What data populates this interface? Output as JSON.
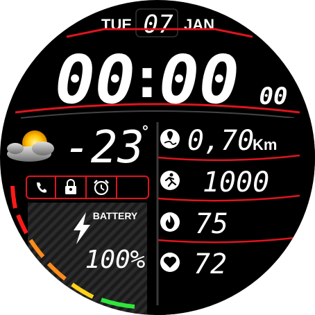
{
  "date": {
    "weekday": "TUE",
    "day": "07",
    "month": "JAN"
  },
  "time": {
    "hours": "00",
    "separator": ":",
    "minutes": "00",
    "seconds": "00"
  },
  "weather": {
    "temperature": "-23",
    "unit": "°",
    "icon": "partly-cloudy-icon"
  },
  "status_icons": [
    "phone-icon",
    "lock-icon",
    "alarm-icon",
    "empty-slot"
  ],
  "battery": {
    "label": "BATTERY",
    "value": "100%",
    "level": 1.0,
    "icon": "lightning-icon"
  },
  "stats": {
    "distance": {
      "value": "0,70",
      "unit": "Km",
      "icon": "distance-map-icon"
    },
    "steps": {
      "value": "1000",
      "icon": "running-person-icon"
    },
    "calories": {
      "value": "75",
      "icon": "flame-icon"
    },
    "heart_rate": {
      "value": "72",
      "icon": "heart-icon"
    }
  },
  "colors": {
    "accent_red": "#e0141e",
    "background": "#000000",
    "scale_left": [
      "#ff1a1a",
      "#ff1a1a",
      "#ff8c1a",
      "#ffd21a",
      "#a0e61a",
      "#2ee63a"
    ],
    "scale_right": [
      "#ff1a1a",
      "#ff1a1a",
      "#c8c8c8",
      "#c8c8c8",
      "#dcdcdc",
      "#ffffff"
    ]
  }
}
